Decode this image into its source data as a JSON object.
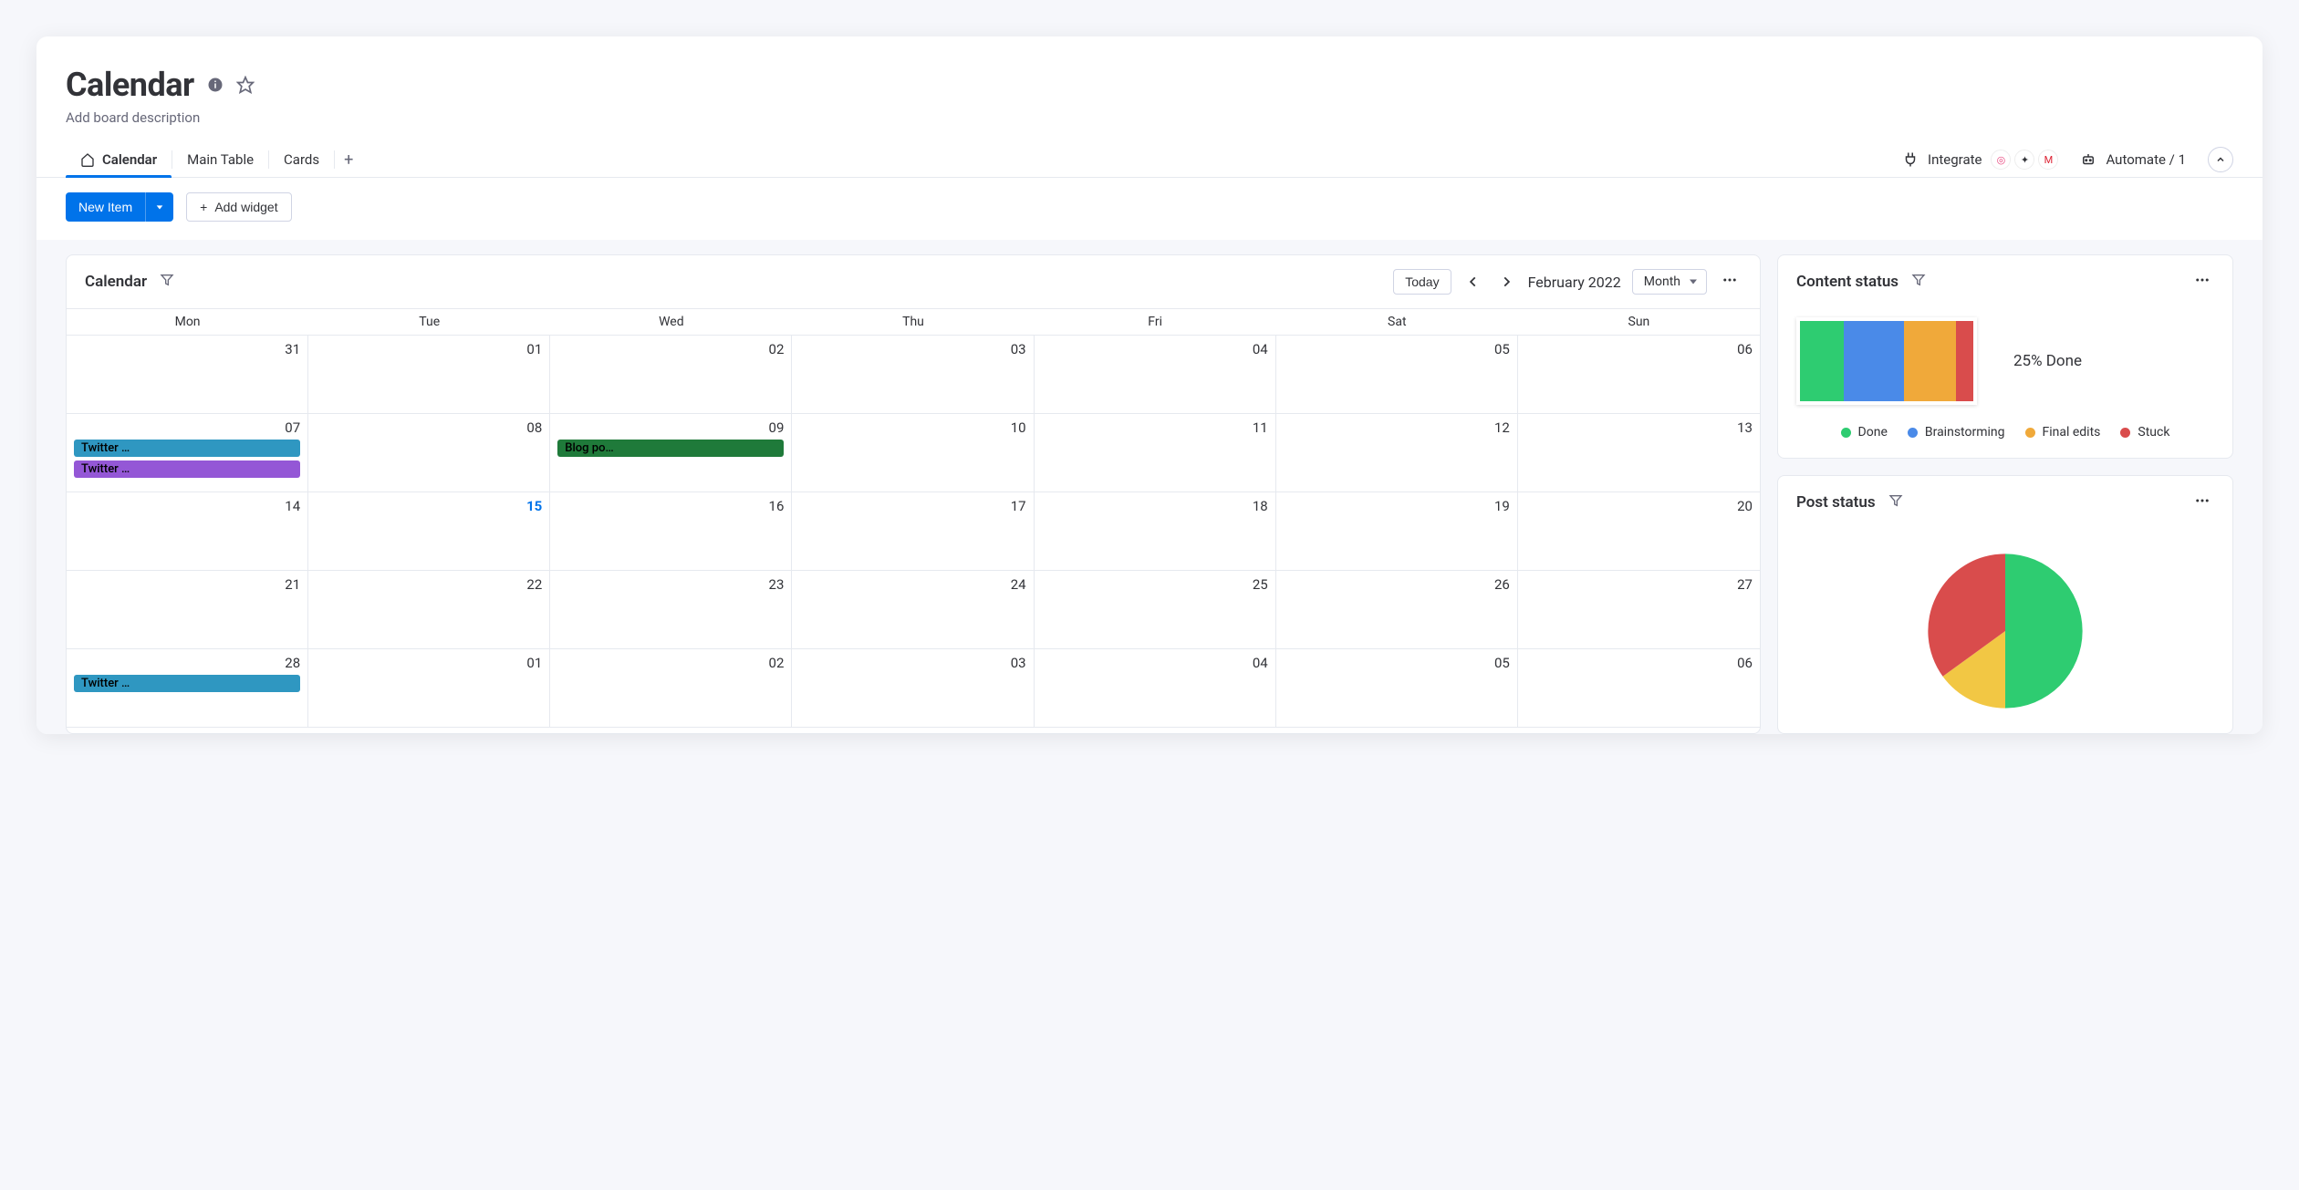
{
  "header": {
    "title": "Calendar",
    "description": "Add board description"
  },
  "tabs": [
    {
      "label": "Calendar",
      "active": true,
      "icon": "home"
    },
    {
      "label": "Main Table",
      "active": false
    },
    {
      "label": "Cards",
      "active": false
    }
  ],
  "right_actions": {
    "integrate": "Integrate",
    "automate": "Automate / 1"
  },
  "actions": {
    "new_item": "New Item",
    "add_widget": "Add widget"
  },
  "calendar_panel": {
    "title": "Calendar",
    "today": "Today",
    "month_label": "February 2022",
    "view": "Month",
    "day_headers": [
      "Mon",
      "Tue",
      "Wed",
      "Thu",
      "Fri",
      "Sat",
      "Sun"
    ],
    "cells": [
      {
        "num": "31"
      },
      {
        "num": "01"
      },
      {
        "num": "02"
      },
      {
        "num": "03"
      },
      {
        "num": "04"
      },
      {
        "num": "05"
      },
      {
        "num": "06"
      },
      {
        "num": "07",
        "events": [
          {
            "label": "Twitter …",
            "color": "#2f97c1"
          },
          {
            "label": "Twitter …",
            "color": "#9457d6"
          }
        ]
      },
      {
        "num": "08"
      },
      {
        "num": "09",
        "events": [
          {
            "label": "Blog po…",
            "color": "#1f7a3a",
            "text": "#000"
          }
        ]
      },
      {
        "num": "10"
      },
      {
        "num": "11"
      },
      {
        "num": "12"
      },
      {
        "num": "13"
      },
      {
        "num": "14"
      },
      {
        "num": "15",
        "today": true
      },
      {
        "num": "16"
      },
      {
        "num": "17"
      },
      {
        "num": "18"
      },
      {
        "num": "19"
      },
      {
        "num": "20"
      },
      {
        "num": "21"
      },
      {
        "num": "22"
      },
      {
        "num": "23"
      },
      {
        "num": "24"
      },
      {
        "num": "25"
      },
      {
        "num": "26"
      },
      {
        "num": "27"
      },
      {
        "num": "28",
        "events": [
          {
            "label": "Twitter …",
            "color": "#2f97c1"
          }
        ]
      },
      {
        "num": "01"
      },
      {
        "num": "02"
      },
      {
        "num": "03"
      },
      {
        "num": "04"
      },
      {
        "num": "05"
      },
      {
        "num": "06"
      }
    ]
  },
  "content_status": {
    "title": "Content status",
    "done_label": "25% Done",
    "legend": [
      {
        "label": "Done",
        "color": "#2ecc71"
      },
      {
        "label": "Brainstorming",
        "color": "#4a8ae8"
      },
      {
        "label": "Final edits",
        "color": "#f0a93a"
      },
      {
        "label": "Stuck",
        "color": "#d94c4c"
      }
    ]
  },
  "post_status": {
    "title": "Post status"
  },
  "chart_data": [
    {
      "type": "bar",
      "id": "content_status_stacked",
      "title": "Content status",
      "categories": [
        "Done",
        "Brainstorming",
        "Final edits",
        "Stuck"
      ],
      "values": [
        25,
        35,
        30,
        10
      ],
      "colors": [
        "#2ecc71",
        "#4a8ae8",
        "#f0a93a",
        "#d94c4c"
      ],
      "annotation": "25% Done"
    },
    {
      "type": "pie",
      "id": "post_status_pie",
      "title": "Post status",
      "series": [
        {
          "name": "Green",
          "value": 50,
          "color": "#2ecc71"
        },
        {
          "name": "Yellow",
          "value": 15,
          "color": "#f2c744"
        },
        {
          "name": "Red",
          "value": 35,
          "color": "#d94c4c"
        }
      ]
    }
  ]
}
